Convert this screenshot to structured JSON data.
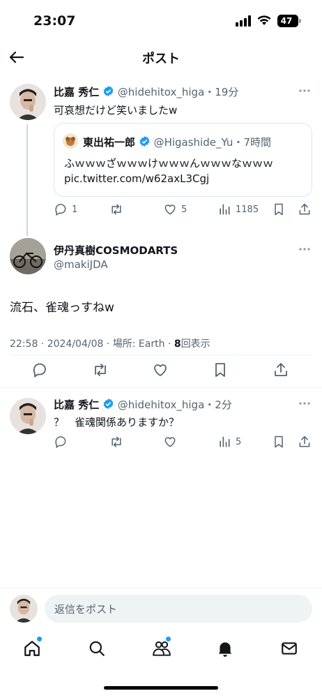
{
  "status_bar": {
    "time": "23:07",
    "battery": "47"
  },
  "header": {
    "title": "ポスト"
  },
  "parent_post": {
    "display_name": "比嘉 秀仁",
    "handle": "@hidehitox_higa",
    "time": "・19分",
    "text": "可哀想だけど笑いましたw",
    "quote": {
      "display_name": "東出祐一郎",
      "handle": "@Higashide_Yu",
      "time": "・7時間",
      "text_line1": "ふｗｗｗざｗｗｗけｗｗｗんｗｗｗなｗｗｗ",
      "text_line2": "pic.twitter.com/w62axL3Cgj"
    },
    "replies": "1",
    "likes": "5",
    "views": "1185"
  },
  "main_post": {
    "display_name": "伊丹真樹COSMODARTS",
    "handle": "@makiJDA",
    "text": "流石、雀魂っすねw",
    "meta": "22:58 · 2024/04/08 · 場所: Earth · ",
    "views_count": "8",
    "views_label": "回表示"
  },
  "reply_post": {
    "display_name": "比嘉 秀仁",
    "handle": "@hidehitox_higa",
    "time": "・2分",
    "text": "？　雀魂関係ありますか？",
    "views": "5"
  },
  "reply_bar": {
    "placeholder": "返信をポスト"
  },
  "colors": {
    "accent": "#1d9bf0",
    "text": "#0f1419",
    "muted": "#536471",
    "border": "#eff3f4"
  },
  "icons": [
    "back-arrow-icon",
    "more-icon",
    "verified-icon",
    "reply-icon",
    "repost-icon",
    "like-icon",
    "views-icon",
    "bookmark-icon",
    "share-icon",
    "home-icon",
    "search-icon",
    "communities-icon",
    "notifications-icon",
    "messages-icon"
  ]
}
